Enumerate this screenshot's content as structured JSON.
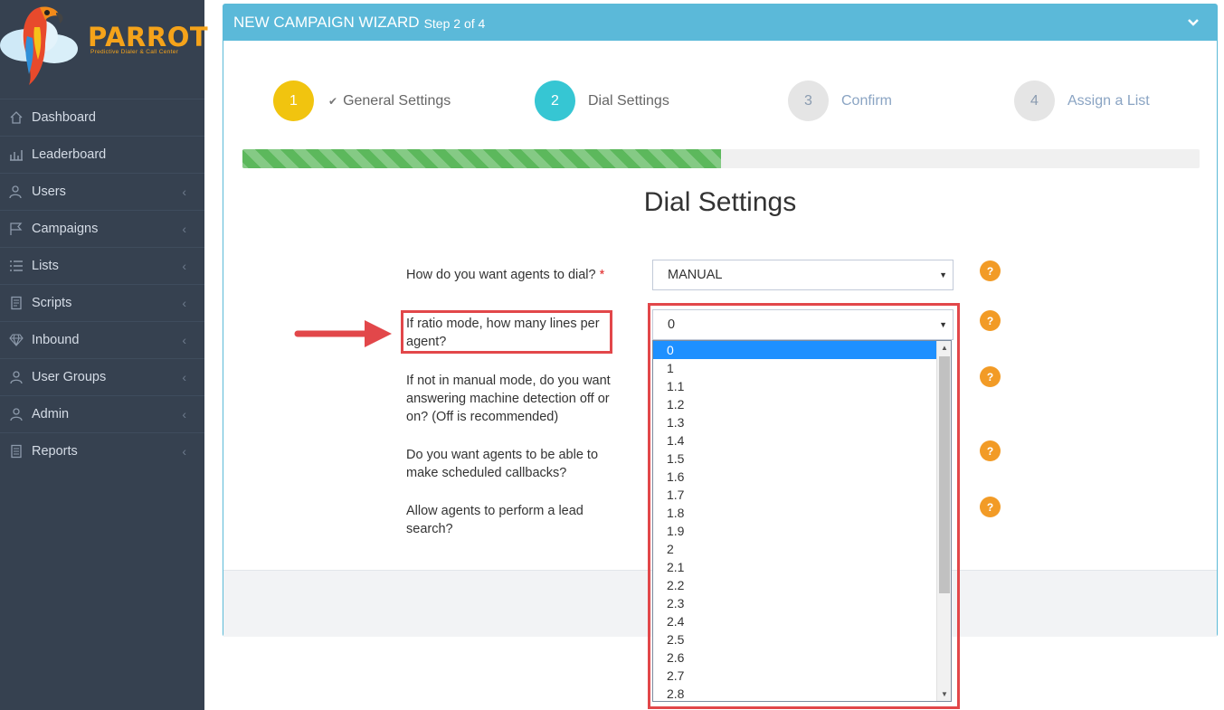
{
  "brand": {
    "name": "PARROT",
    "tagline": "Predictive Dialer & Call Center"
  },
  "nav": [
    {
      "label": "Dashboard",
      "icon": "home-icon",
      "has_submenu": false
    },
    {
      "label": "Leaderboard",
      "icon": "bar-chart-icon",
      "has_submenu": false
    },
    {
      "label": "Users",
      "icon": "users-icon",
      "has_submenu": true
    },
    {
      "label": "Campaigns",
      "icon": "flag-icon",
      "has_submenu": true
    },
    {
      "label": "Lists",
      "icon": "list-icon",
      "has_submenu": true
    },
    {
      "label": "Scripts",
      "icon": "script-icon",
      "has_submenu": true
    },
    {
      "label": "Inbound",
      "icon": "diamond-icon",
      "has_submenu": true
    },
    {
      "label": "User Groups",
      "icon": "user-groups-icon",
      "has_submenu": true
    },
    {
      "label": "Admin",
      "icon": "admin-user-icon",
      "has_submenu": true
    },
    {
      "label": "Reports",
      "icon": "report-icon",
      "has_submenu": true
    }
  ],
  "wizard": {
    "title": "NEW CAMPAIGN WIZARD",
    "subtitle": "Step 2 of 4",
    "steps": [
      {
        "number": "1",
        "label": "General Settings",
        "state": "done"
      },
      {
        "number": "2",
        "label": "Dial Settings",
        "state": "active"
      },
      {
        "number": "3",
        "label": "Confirm",
        "state": "pending"
      },
      {
        "number": "4",
        "label": "Assign a List",
        "state": "pending"
      }
    ],
    "progress_fraction": 0.5,
    "section_title": "Dial Settings",
    "fields": [
      {
        "label": "How do you want agents to dial?",
        "required": true,
        "value": "MANUAL"
      },
      {
        "label": "If ratio mode, how many lines per agent?",
        "required": false,
        "value": "0"
      },
      {
        "label": "If not in manual mode, do you want answering machine detection off or on? (Off is recommended)",
        "required": false
      },
      {
        "label": "Do you want agents to be able to make scheduled callbacks?",
        "required": false
      },
      {
        "label": "Allow agents to perform a lead search?",
        "required": false
      }
    ],
    "help_glyph": "?",
    "required_mark": "*"
  },
  "ratio_options": [
    "0",
    "1",
    "1.1",
    "1.2",
    "1.3",
    "1.4",
    "1.5",
    "1.6",
    "1.7",
    "1.8",
    "1.9",
    "2",
    "2.1",
    "2.2",
    "2.3",
    "2.4",
    "2.5",
    "2.6",
    "2.7",
    "2.8"
  ],
  "selected_ratio_index": 0,
  "colors": {
    "sidebar": "#364150",
    "panel_header": "#5bb9d9",
    "step_done": "#f1c40f",
    "step_active": "#36c6d3",
    "step_pending": "#e5e5e5",
    "progress": "#5cb85c",
    "help": "#f29b26",
    "highlight": "#e2474a",
    "option_selected": "#1e90ff"
  }
}
